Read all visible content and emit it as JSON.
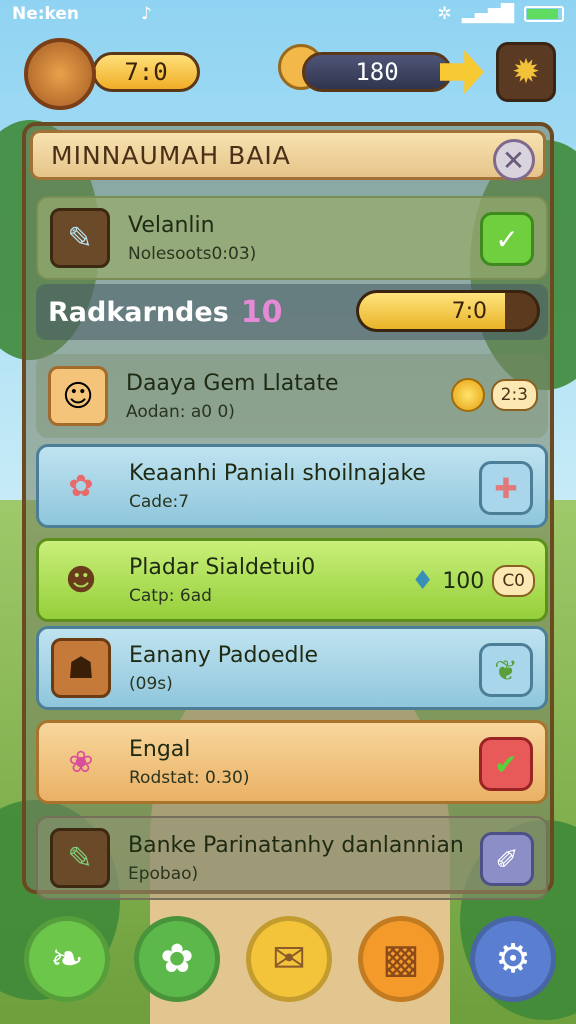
{
  "status_bar": {
    "carrier": "Ne:ken",
    "battery_level": 0.9
  },
  "hud": {
    "gold_value": "7:0",
    "gem_value": "180"
  },
  "panel": {
    "title": "MINNAUMAH BAIA",
    "rows": [
      {
        "title": "Velanlin",
        "subtitle": "Nolesoots0:03)"
      },
      {
        "title": "Daaya Gem Llatate",
        "subtitle": "Aodan: a0 0)",
        "badge": "2:3"
      },
      {
        "title": "Keaanhi Panialı shoilnajake",
        "subtitle": "Cade:7"
      },
      {
        "title": "Pladar Sialdetui0",
        "subtitle": "Catp: 6ad",
        "value": "100",
        "badge": "C0"
      },
      {
        "title": "Eanany Padoedle",
        "subtitle": "(09s)"
      },
      {
        "title": "Engal",
        "subtitle": "Rodstat: 0.30)"
      },
      {
        "title": "Banke Parinatanhy danlannian",
        "subtitle": "Epobao)"
      }
    ],
    "section": {
      "label": "Radkarndes",
      "count": "10",
      "progress_label": "7:0",
      "progress_fraction": 0.82
    }
  },
  "icons": {
    "close": "close-icon",
    "settings": "gear-icon"
  }
}
